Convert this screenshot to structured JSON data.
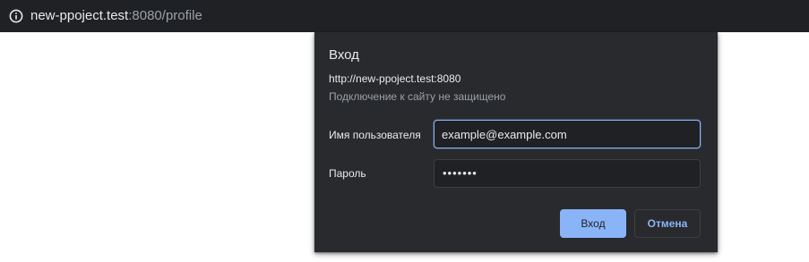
{
  "addressbar": {
    "icon": "info-icon",
    "url_host": "new-ppoject.test",
    "url_rest": ":8080/profile"
  },
  "dialog": {
    "title": "Вход",
    "site": "http://new-ppoject.test:8080",
    "warning": "Подключение к сайту не защищено",
    "username_label": "Имя пользователя",
    "username_value": "example@example.com",
    "password_label": "Пароль",
    "password_masked": "•••••••",
    "login_button": "Вход",
    "cancel_button": "Отмена"
  },
  "colors": {
    "chrome_dark": "#202124",
    "dialog_bg": "#292a2d",
    "accent_blue": "#8ab4f8",
    "text_primary": "#e8eaed",
    "text_secondary": "#9aa0a6"
  }
}
